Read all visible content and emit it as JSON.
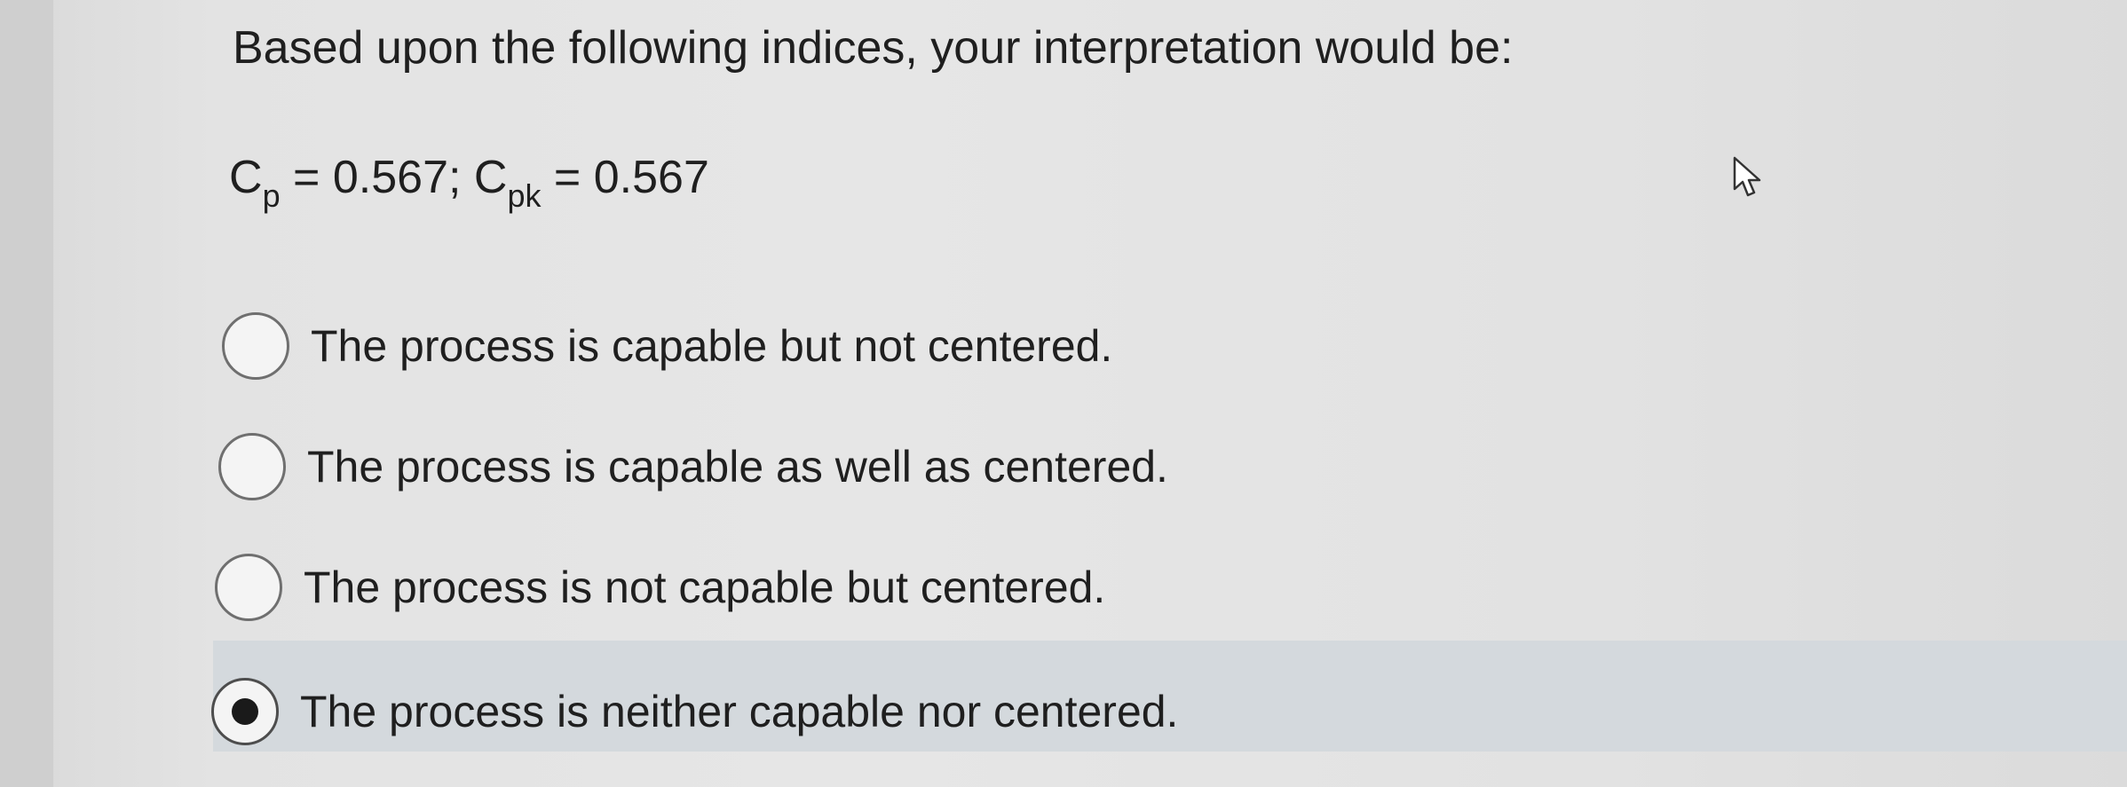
{
  "question": {
    "prompt": "Based upon the following indices, your interpretation would be:",
    "formula": {
      "cp_symbol": "C",
      "cp_sub": "p",
      "cp_value": " = 0.567; ",
      "cpk_symbol": "C",
      "cpk_sub": "pk",
      "cpk_value": " = 0.567"
    }
  },
  "options": [
    {
      "label": "The process is capable but not centered.",
      "selected": false
    },
    {
      "label": "The process is capable as well as centered.",
      "selected": false
    },
    {
      "label": "The process is not capable but centered.",
      "selected": false
    },
    {
      "label": "The process is neither capable nor centered.",
      "selected": true
    }
  ],
  "colors": {
    "selected_highlight": "#d4d9dd",
    "text": "#1f1f1f"
  },
  "icons": {
    "cursor": "mouse-pointer-icon"
  }
}
